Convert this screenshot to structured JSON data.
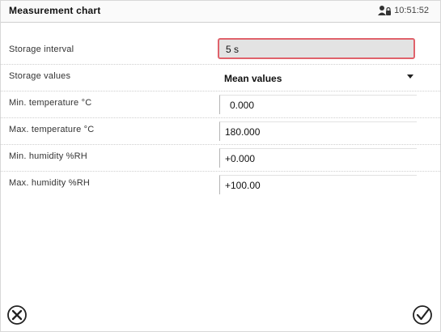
{
  "header": {
    "title": "Measurement chart",
    "time": "10:51:52",
    "user_icon": "user-lock-icon"
  },
  "settings": [
    {
      "label": "Storage interval",
      "value": "5 s"
    },
    {
      "label": "Storage values",
      "value": "Mean values",
      "options_icon": "chevron-down-icon"
    },
    {
      "label": "Min. temperature °C",
      "value": "0.000"
    },
    {
      "label": "Max. temperature °C",
      "value": "180.000"
    },
    {
      "label": "Min. humidity %RH",
      "value": "+0.000"
    },
    {
      "label": "Max. humidity %RH",
      "value": "+100.00"
    }
  ],
  "footer": {
    "cancel_icon": "close-circle-icon",
    "confirm_icon": "check-circle-icon"
  },
  "colors": {
    "focus_border": "#e0626b",
    "selected_field_bg": "#e3e3e3"
  }
}
